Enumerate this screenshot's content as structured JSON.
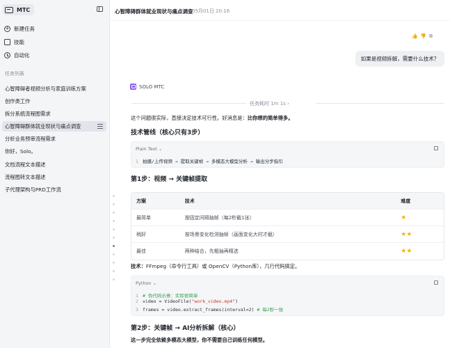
{
  "app": {
    "name": "MTC"
  },
  "sidebar": {
    "nav": [
      {
        "label": "新建任务",
        "icon": "plus-circle-icon"
      },
      {
        "label": "技能",
        "icon": "box-icon"
      },
      {
        "label": "自动化",
        "icon": "clock-icon"
      }
    ],
    "section_title": "任务列表",
    "tasks": [
      "心智障碍者视频分析与家庭训练方案",
      "创作类工作",
      "拆分系统流程图需求",
      "心智障碍群体就业现状与痛点调查",
      "分析业务预审流程需求",
      "你好，Solo。",
      "文档流程文本描述",
      "流程图转文本描述",
      "子代理架构与PRD工作流"
    ]
  },
  "header": {
    "title": "心智障碍群体就业现状与痛点调查",
    "date": "05月01日 20:16"
  },
  "chat": {
    "user_message": "如果是视频拆解，需要什么技术？",
    "agent_name": "SOLO MTC",
    "elapsed": "任务耗时 1m 1s ›",
    "intro_plain": "这个问题很实际，直接决定技术可行性。好消息是：",
    "intro_bold": "比你想的简单得多。",
    "h_pipeline": "技术管线（核心只有3步）",
    "code1": {
      "lang": "Plain Text ⌄",
      "lines": [
        {
          "no": "1",
          "text": "拍摄/上传视频 → 提取关键帧 → 多模态大模型分析 → 输出分步指引"
        }
      ]
    },
    "h_step1": "第1步：视频 → 关键帧提取",
    "table": {
      "headers": [
        "方案",
        "技术",
        "难度"
      ],
      "rows": [
        {
          "plan": "最简单",
          "tech": "按固定间隔抽帧（每2秒截1张）",
          "stars": "★"
        },
        {
          "plan": "稍好",
          "tech": "按场景变化检测抽帧（画面变化大时才截）",
          "stars": "★★"
        },
        {
          "plan": "最佳",
          "tech": "两种结合，先粗抽再精选",
          "stars": "★★"
        }
      ]
    },
    "tech_label": "技术：",
    "tech_text": "FFmpeg（命令行工具）或 OpenCV（Python库），几行代码搞定。",
    "code2": {
      "lang": "Python ⌄",
      "line1_no": "1",
      "line1": "# 伪代码示意：实际很简单",
      "line2_no": "2",
      "line2_a": "video = VideoFile(",
      "line2_str": "\"work_video.mp4\"",
      "line2_b": ")",
      "line3_no": "3",
      "line3_a": "frames = video.extract_frames(interval=2)  ",
      "line3_cm": "# 每2秒一张"
    },
    "h_step2": "第2步：关键帧 → AI分析拆解（核心）",
    "closing": "这一步完全依赖多模态大模型，你不需要自己训练任何模型。"
  }
}
